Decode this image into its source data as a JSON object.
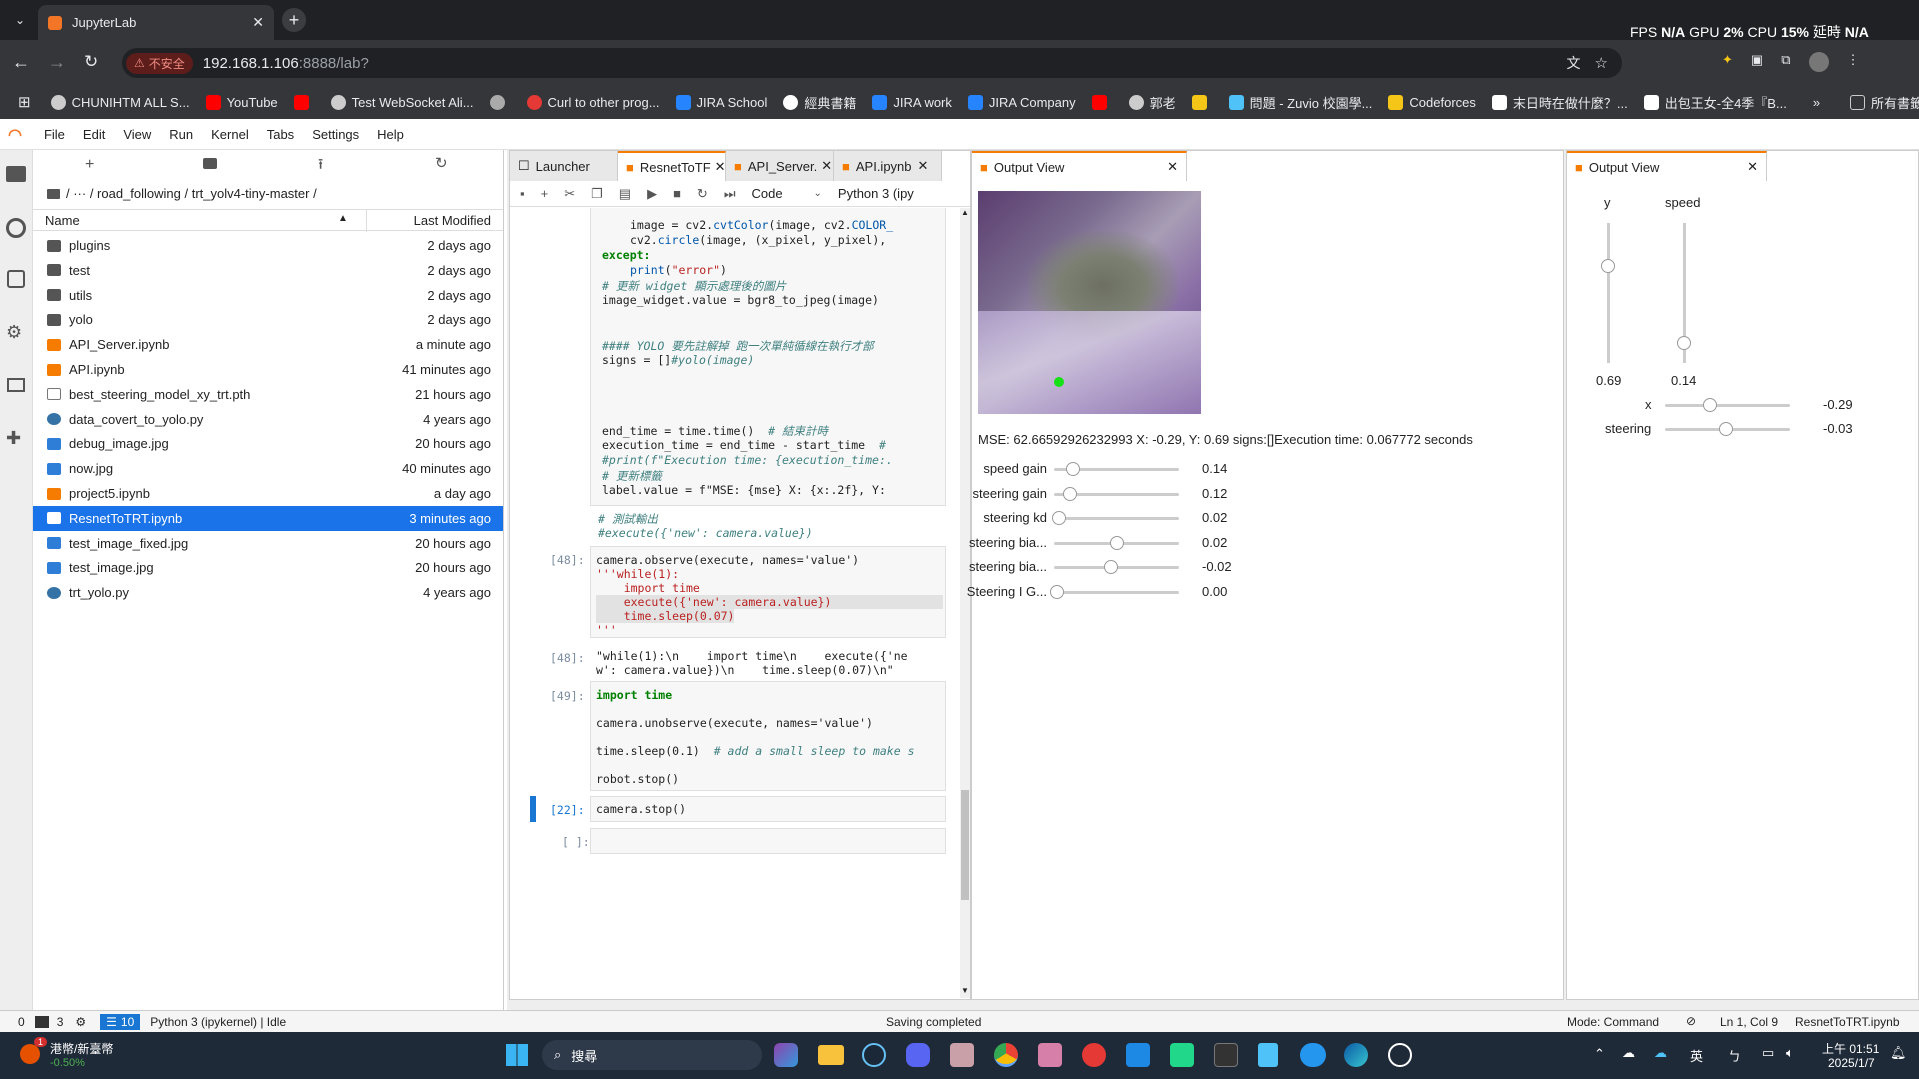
{
  "browser": {
    "tab_title": "JupyterLab",
    "address": "192.168.1.106",
    "address_rest": ":8888/lab?",
    "insecure_label": "不安全",
    "perf": {
      "fps_label": "FPS",
      "fps": "N/A",
      "gpu_label": "GPU",
      "gpu": "2",
      "cpu_label": "CPU",
      "cpu": "15",
      "lat_label": "延時",
      "lat": "N/A"
    },
    "bookmarks": [
      "CHUNIHTM ALL S...",
      "YouTube",
      "",
      "Test WebSocket Ali...",
      "",
      "Curl to other prog...",
      "JIRA School",
      "經典書籍",
      "JIRA work",
      "JIRA Company",
      "",
      "郭老",
      "",
      "問題 - Zuvio 校園學...",
      "Codeforces",
      "末日時在做什麼？...",
      "出包王女-全4季『B..."
    ],
    "bookmarks_all": "所有書籤"
  },
  "menu": [
    "File",
    "Edit",
    "View",
    "Run",
    "Kernel",
    "Tabs",
    "Settings",
    "Help"
  ],
  "filebrowser": {
    "breadcrumb": "/ ··· / road_following / trt_yolv4-tiny-master /",
    "col_name": "Name",
    "col_modified": "Last Modified",
    "files": [
      {
        "name": "plugins",
        "time": "2 days ago",
        "type": "folder"
      },
      {
        "name": "test",
        "time": "2 days ago",
        "type": "folder"
      },
      {
        "name": "utils",
        "time": "2 days ago",
        "type": "folder"
      },
      {
        "name": "yolo",
        "time": "2 days ago",
        "type": "folder"
      },
      {
        "name": "API_Server.ipynb",
        "time": "a minute ago",
        "type": "notebook"
      },
      {
        "name": "API.ipynb",
        "time": "41 minutes ago",
        "type": "notebook"
      },
      {
        "name": "best_steering_model_xy_trt.pth",
        "time": "21 hours ago",
        "type": "file"
      },
      {
        "name": "data_covert_to_yolo.py",
        "time": "4 years ago",
        "type": "python"
      },
      {
        "name": "debug_image.jpg",
        "time": "20 hours ago",
        "type": "image"
      },
      {
        "name": "now.jpg",
        "time": "40 minutes ago",
        "type": "image"
      },
      {
        "name": "project5.ipynb",
        "time": "a day ago",
        "type": "notebook"
      },
      {
        "name": "ResnetToTRT.ipynb",
        "time": "3 minutes ago",
        "type": "notebook"
      },
      {
        "name": "test_image_fixed.jpg",
        "time": "20 hours ago",
        "type": "image"
      },
      {
        "name": "test_image.jpg",
        "time": "20 hours ago",
        "type": "image"
      },
      {
        "name": "trt_yolo.py",
        "time": "4 years ago",
        "type": "python"
      }
    ]
  },
  "notebook_tabs": [
    "Launcher",
    "ResnetToTF",
    "API_Server.",
    "API.ipynb"
  ],
  "toolbar": {
    "cell_type": "Code",
    "kernel": "Python 3 (ipy"
  },
  "code": {
    "l1a": "image = cv2.",
    "l1b": "cvtColor",
    "l1c": "(image, cv2.",
    "l1d": "COLOR_",
    "l2a": "cv2.",
    "l2b": "circle",
    "l2c": "(image, (x_pixel, y_pixel),",
    "l3": "except:",
    "l4a": "print",
    "l4b": "(",
    "l4c": "\"error\"",
    "l4d": ")",
    "l5": "# 更新 widget 顯示處理後的圖片",
    "l6": "image_widget.value = bgr8_to_jpeg(image)",
    "l7": "#### YOLO 要先註解掉 跑一次單純循線在執行才部",
    "l8a": "signs = []",
    "l8b": "#yolo(image)",
    "l9a": "end_time = time.time()  ",
    "l9b": "# 結束計時",
    "l10a": "execution_time = end_time - start_time  ",
    "l10b": "#",
    "l11": "#print(f\"Execution time: {execution_time:.",
    "l12": "# 更新標籤",
    "l13a": "label.value = f\"MSE: {mse} X: {x:.2f}, Y:",
    "l14": "# 測試輸出",
    "l15": "#execute({'new': camera.value})",
    "c48_prompt": "[48]:",
    "c48_1": "camera.observe(execute, names='value')",
    "c48_2": "'''while(1):",
    "c48_3": "    import time",
    "c48_4": "    execute({'new': camera.value})",
    "c48_5": "    time.sleep(0.07)",
    "c48_6": "'''",
    "o48_prompt": "[48]:",
    "o48_1": "\"while(1):\\n    import time\\n    execute({'ne",
    "o48_2": "w': camera.value})\\n    time.sleep(0.07)\\n\"",
    "c49_prompt": "[49]:",
    "c49_1": "import time",
    "c49_2": "camera.unobserve(execute, names='value')",
    "c49_3a": "time.sleep(0.1)  ",
    "c49_3b": "# add a small sleep to make s",
    "c49_4": "robot.stop()",
    "c22_prompt": "[22]:",
    "c22_1": "camera.stop()",
    "empty_prompt": "[ ]:"
  },
  "output_view1": {
    "title": "Output View",
    "mse_label": "MSE: 62.66592926232993 X: -0.29, Y: 0.69 signs:[]Execution time: 0.067772 seconds",
    "sliders": [
      {
        "label": "speed gain",
        "value": "0.14",
        "pos": 0.14
      },
      {
        "label": "steering gain",
        "value": "0.12",
        "pos": 0.12
      },
      {
        "label": "steering kd",
        "value": "0.02",
        "pos": 0.02
      },
      {
        "label": "steering bia...",
        "value": "0.02",
        "pos": 0.54
      },
      {
        "label": "steering bia...",
        "value": "-0.02",
        "pos": 0.48
      },
      {
        "label": "Steering I G...",
        "value": "0.00",
        "pos": 0.0
      }
    ]
  },
  "output_view2": {
    "title": "Output View",
    "y_label": "y",
    "y_value": "0.69",
    "y_pos": 0.69,
    "speed_label": "speed",
    "speed_value": "0.14",
    "speed_pos": 0.14,
    "x_label": "x",
    "x_value": "-0.29",
    "x_pos": 0.36,
    "steering_label": "steering",
    "steering_value": "-0.03",
    "steering_pos": 0.49
  },
  "status": {
    "left1": "0",
    "left2": "3",
    "cells": "10",
    "kernel": "Python 3 (ipykernel) | Idle",
    "center": "Saving completed",
    "mode": "Mode: Command",
    "pos": "Ln 1, Col 9",
    "file": "ResnetToTRT.ipynb"
  },
  "taskbar": {
    "weather1": "港幣/新臺幣",
    "weather2": "-0.50%",
    "search": "搜尋",
    "ime": "英",
    "time": "上午 01:51",
    "date": "2025/1/7",
    "badge": "1"
  }
}
